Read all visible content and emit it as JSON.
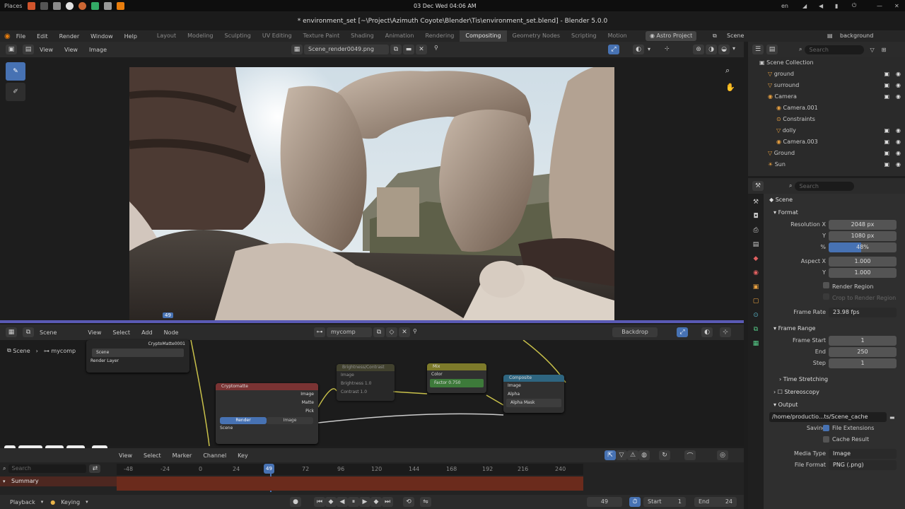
{
  "os": {
    "places": "Places",
    "datetime": "03 Dec Wed 04:06 AM",
    "locale": "en"
  },
  "window": {
    "title": "* environment_set [~\\Project\\Azimuth Coyote\\Blender\\Tis\\environment_set.blend] - Blender 5.0.0"
  },
  "menu": [
    "File",
    "Edit",
    "Render",
    "Window",
    "Help"
  ],
  "workspaces": [
    "Layout",
    "Modeling",
    "Sculpting",
    "UV Editing",
    "Texture Paint",
    "Shading",
    "Animation",
    "Rendering",
    "Compositing",
    "Geometry Nodes",
    "Scripting",
    "Motion"
  ],
  "active_workspace": "Compositing",
  "active_project": "Astro Project",
  "scene_label": "Scene",
  "viewlayer_label": "background",
  "image_editor": {
    "menu": [
      "View",
      "View",
      "Image"
    ],
    "image_name": "Scene_render0049.png",
    "frame_badge": "49"
  },
  "node_editor": {
    "scene": "Scene",
    "menu": [
      "View",
      "Select",
      "Add",
      "Node"
    ],
    "tree_name": "mycomp",
    "backdrop": "Backdrop",
    "breadcrumb": [
      "Scene",
      "mycomp"
    ],
    "nodes": {
      "image_node": {
        "title": "CryptoMatte0001",
        "rows": [
          "Scene",
          "Render Layer"
        ]
      },
      "cryptomatte": {
        "title": "Cryptomatte",
        "outputs": [
          "Image",
          "Matte",
          "Pick"
        ],
        "toggles": [
          "Render",
          "Image"
        ],
        "source": "Scene"
      },
      "gamma": {
        "title": "Brightness/Contrast",
        "rows": [
          "Image",
          "Brightness  1.0",
          "Contrast  1.0"
        ]
      },
      "mix": {
        "title": "Mix",
        "rows": [
          "Color",
          "Factor  0.750"
        ]
      },
      "composite": {
        "title": "Composite",
        "rows": [
          "Image",
          "Alpha",
          "Alpha Mask"
        ]
      }
    }
  },
  "timeline": {
    "menu": [
      "View",
      "Select",
      "Marker",
      "Channel",
      "Key"
    ],
    "ticks": [
      "-48",
      "-24",
      "0",
      "24",
      "48",
      "72",
      "96",
      "120",
      "144",
      "168",
      "192",
      "216",
      "240"
    ],
    "current_frame": "49",
    "channel": "Summary",
    "playback": "Playback",
    "keying": "Keying",
    "start_label": "Start",
    "start_value": "1",
    "end_label": "End",
    "end_value": "24"
  },
  "outliner": {
    "search_placeholder": "Search",
    "collection": "Scene Collection",
    "items": [
      {
        "label": "ground",
        "indent": 1
      },
      {
        "label": "surround",
        "indent": 1
      },
      {
        "label": "Camera",
        "indent": 1
      },
      {
        "label": "Camera.001",
        "indent": 2
      },
      {
        "label": "Constraints",
        "indent": 2
      },
      {
        "label": "dolly",
        "indent": 2
      },
      {
        "label": "Camera.003",
        "indent": 2
      },
      {
        "label": "Ground",
        "indent": 1
      },
      {
        "label": "Sun",
        "indent": 1
      }
    ]
  },
  "properties": {
    "search_placeholder": "Search",
    "context": "Scene",
    "format": {
      "title": "Format",
      "resolution_x_label": "Resolution X",
      "resolution_x": "2048 px",
      "y_label": "Y",
      "resolution_y": "1080 px",
      "pct_label": "%",
      "resolution_pct": "48%",
      "resolution_pct_value": 0.48,
      "aspect_x_label": "Aspect X",
      "aspect_x": "1.000",
      "aspect_y": "1.000",
      "render_region": "Render Region",
      "crop": "Crop to Render Region",
      "frame_rate_label": "Frame Rate",
      "frame_rate": "23.98 fps"
    },
    "frame_range": {
      "title": "Frame Range",
      "start_label": "Frame Start",
      "start": "1",
      "end_label": "End",
      "end": "250",
      "step_label": "Step",
      "step": "1"
    },
    "time_stretching": "Time Stretching",
    "stereoscopy": "Stereoscopy",
    "output": {
      "title": "Output",
      "path": "/home/productio...ts/Scene_cache",
      "saving_label": "Saving",
      "file_extensions": "File Extensions",
      "cache_result": "Cache Result",
      "media_type_label": "Media Type",
      "media_type": "Image",
      "file_format_label": "File Format",
      "file_format": "PNG (.png)"
    }
  },
  "colors": {
    "accent": "#4772b3",
    "selection": "#ff9f1a",
    "timeline_bar": "#6b2b1c"
  }
}
